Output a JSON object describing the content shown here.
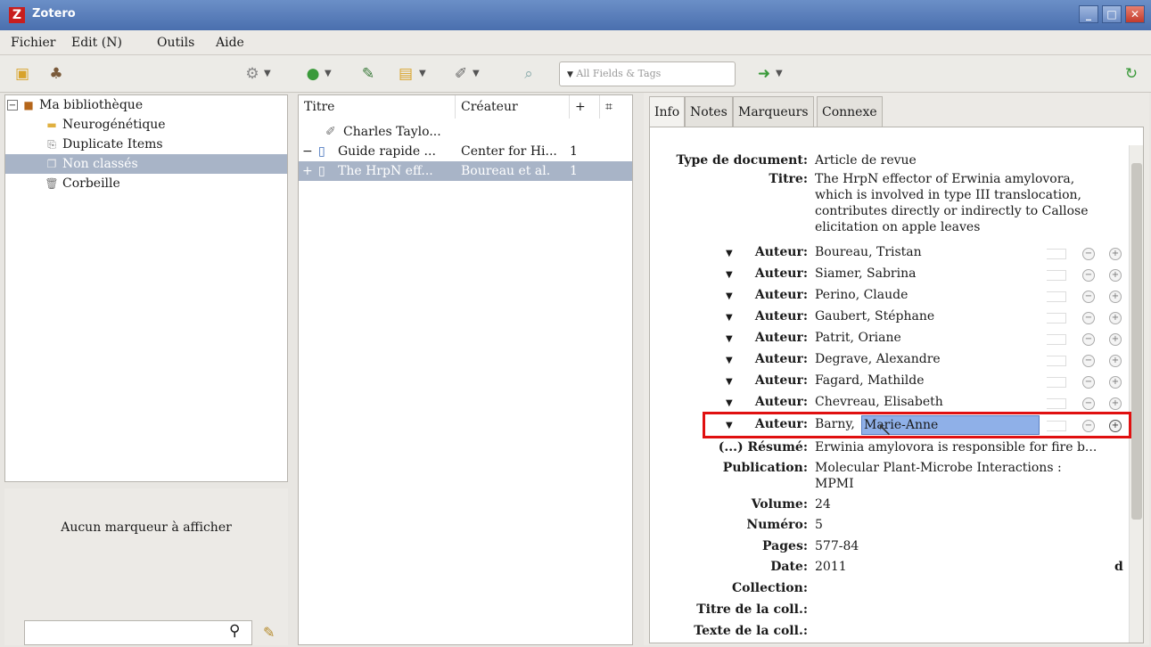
{
  "window": {
    "title": "Zotero",
    "logo": "Z"
  },
  "menu": [
    "Fichier",
    "Edit (N)",
    "Outils",
    "Aide"
  ],
  "toolbar": {
    "search_placeholder": "All Fields & Tags"
  },
  "library": {
    "items": [
      {
        "label": "Ma bibliothèque",
        "icon": "library-icon"
      },
      {
        "label": "Neurogénétique",
        "icon": "folder-icon"
      },
      {
        "label": "Duplicate Items",
        "icon": "duplicate-icon"
      },
      {
        "label": "Non classés",
        "icon": "unfiled-icon",
        "selected": true
      },
      {
        "label": "Corbeille",
        "icon": "trash-icon"
      }
    ]
  },
  "tags": {
    "empty_message": "Aucun marqueur à afficher"
  },
  "items_list": {
    "columns": {
      "title": "Titre",
      "creator": "Créateur",
      "plus": "+"
    },
    "rows": [
      {
        "title": "Charles Taylo...",
        "creator": "",
        "count": ""
      },
      {
        "title": "Guide rapide ...",
        "creator": "Center for Hi...",
        "count": "1"
      },
      {
        "title": "The HrpN eff...",
        "creator": "Boureau et al.",
        "count": "1"
      }
    ]
  },
  "tabs": [
    "Info",
    "Notes",
    "Marqueurs",
    "Connexe"
  ],
  "info": {
    "type_label": "Type de document:",
    "type_value": "Article de revue",
    "title_label": "Titre:",
    "title_lines": [
      "The HrpN effector of Erwinia amylovora,",
      "which is involved in type III translocation,",
      "contributes directly or indirectly to Callose",
      "elicitation on apple leaves"
    ],
    "author_label": "Auteur:",
    "authors": [
      "Boureau, Tristan",
      "Siamer, Sabrina",
      "Perino, Claude",
      "Gaubert, Stéphane",
      "Patrit, Oriane",
      "Degrave, Alexandre",
      "Fagard, Mathilde",
      "Chevreau, Elisabeth"
    ],
    "editing_author_last": "Barny,",
    "editing_author_first": "Marie-Anne",
    "abstract_label": "(...) Résumé:",
    "abstract_value": "Erwinia amylovora is responsible for fire b...",
    "publication_label": "Publication:",
    "publication_lines": [
      "Molecular Plant-Microbe Interactions :",
      "MPMI"
    ],
    "volume_label": "Volume:",
    "volume_value": "24",
    "issue_label": "Numéro:",
    "issue_value": "5",
    "pages_label": "Pages:",
    "pages_value": "577-84",
    "date_label": "Date:",
    "date_value": "2011",
    "date_badge": "d",
    "collection_label": "Collection:",
    "coll_title_label": "Titre de la coll.:",
    "coll_text_label": "Texte de la coll.:"
  }
}
